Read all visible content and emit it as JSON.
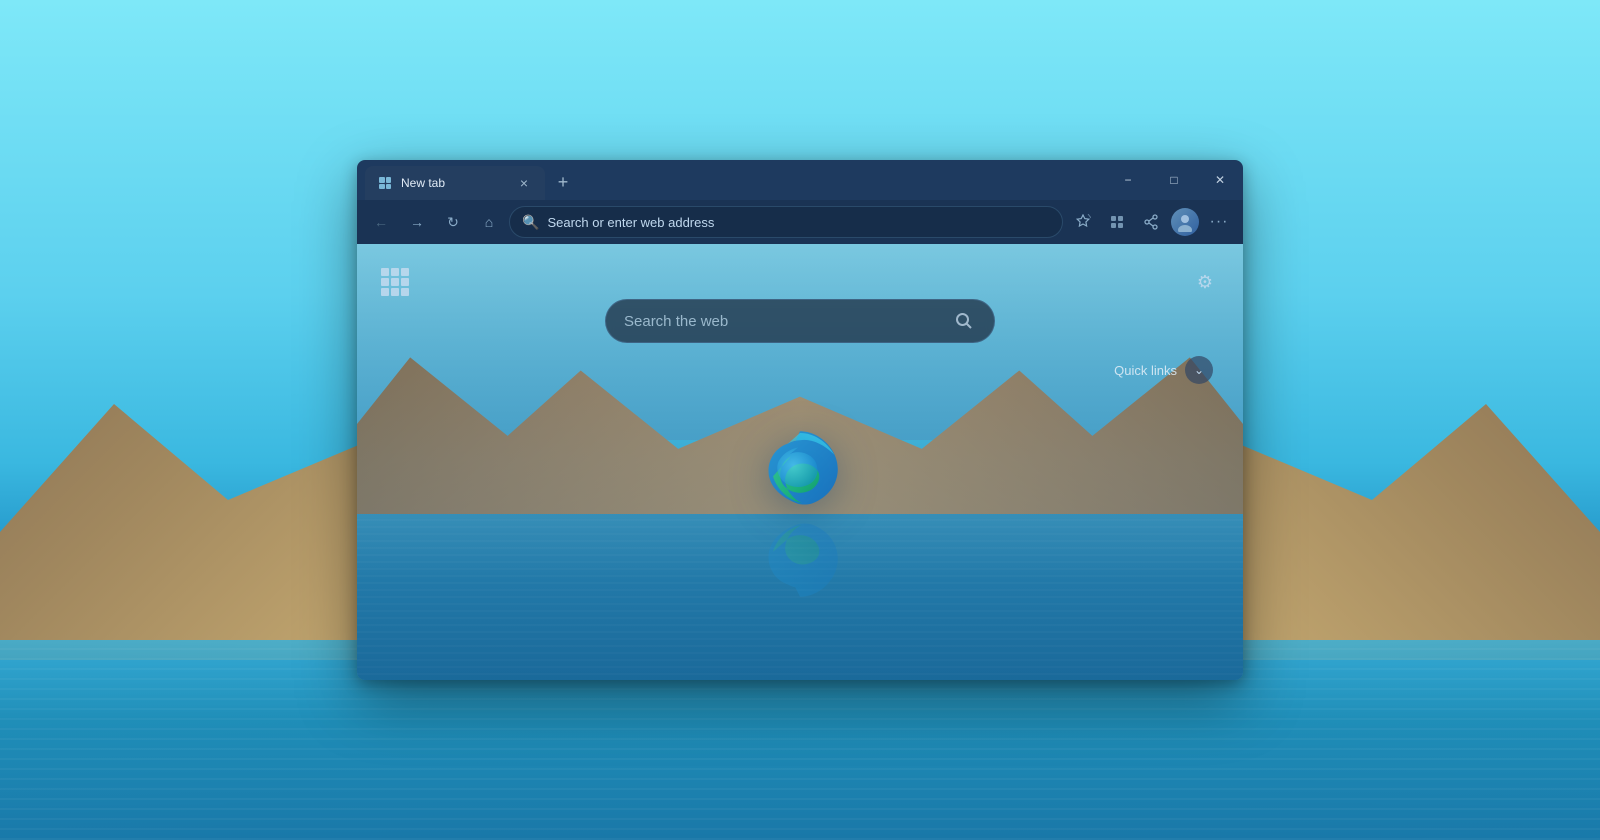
{
  "desktop": {
    "bg_description": "Windows 11 desktop with cyan-blue landscape wallpaper"
  },
  "browser": {
    "title": "Microsoft Edge",
    "tab": {
      "label": "New tab",
      "favicon": "grid-icon",
      "close_label": "×"
    },
    "new_tab_button_label": "+",
    "window_controls": {
      "minimize": "−",
      "maximize": "□",
      "close": "✕"
    },
    "nav": {
      "back_label": "←",
      "forward_label": "→",
      "refresh_label": "↻",
      "home_label": "⌂",
      "address_placeholder": "Search or enter web address"
    },
    "toolbar": {
      "favorites_label": "☆",
      "collections_label": "⊞",
      "share_label": "⤤",
      "more_label": "···"
    }
  },
  "new_tab_page": {
    "search_placeholder": "Search the web",
    "search_icon": "🔍",
    "quick_links_label": "Quick links",
    "quick_links_chevron": "⌄",
    "settings_icon": "⚙",
    "apps_icon": "apps-grid",
    "edge_logo_alt": "Microsoft Edge logo"
  }
}
